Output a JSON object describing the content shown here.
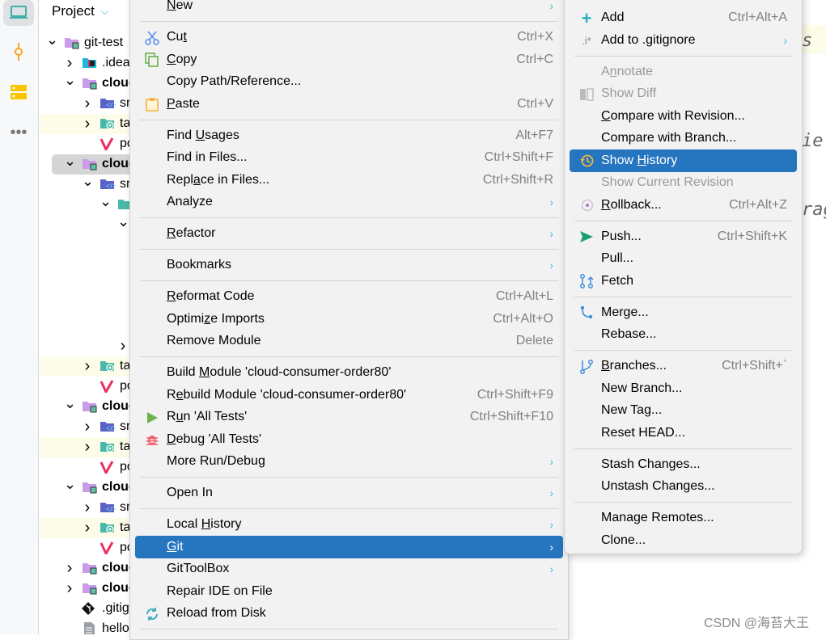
{
  "project": {
    "title": "Project",
    "rows": [
      {
        "lvl": 0,
        "ch": "v",
        "ic": "module",
        "t": "git-test"
      },
      {
        "lvl": 1,
        "ch": ">",
        "ic": "idea",
        "t": ".idea"
      },
      {
        "lvl": 1,
        "ch": "v",
        "ic": "module",
        "t": "cloud",
        "b": true
      },
      {
        "lvl": 2,
        "ch": ">",
        "ic": "src",
        "t": "src"
      },
      {
        "lvl": 2,
        "ch": ">",
        "ic": "target",
        "t": "target",
        "hl": true
      },
      {
        "lvl": 2,
        "ch": "",
        "ic": "maven",
        "t": "pom.xml"
      },
      {
        "lvl": 1,
        "ch": "v",
        "ic": "module",
        "t": "cloud",
        "b": true,
        "sel": true
      },
      {
        "lvl": 2,
        "ch": "v",
        "ic": "src",
        "t": "src"
      },
      {
        "lvl": 3,
        "ch": "v",
        "ic": "folder",
        "t": ""
      },
      {
        "lvl": 4,
        "ch": "v",
        "ic": "",
        "t": ""
      },
      {
        "lvl": 4,
        "ch": "",
        "ic": "",
        "t": ""
      },
      {
        "lvl": 4,
        "ch": "",
        "ic": "",
        "t": ""
      },
      {
        "lvl": 4,
        "ch": "",
        "ic": "",
        "t": ""
      },
      {
        "lvl": 4,
        "ch": "",
        "ic": "",
        "t": ""
      },
      {
        "lvl": 4,
        "ch": "",
        "ic": "",
        "t": ""
      },
      {
        "lvl": 4,
        "ch": ">",
        "ic": "",
        "t": ""
      },
      {
        "lvl": 2,
        "ch": ">",
        "ic": "target",
        "t": "target",
        "hl": true
      },
      {
        "lvl": 2,
        "ch": "",
        "ic": "maven",
        "t": "pom.xml"
      },
      {
        "lvl": 1,
        "ch": "v",
        "ic": "module",
        "t": "cloud",
        "b": true
      },
      {
        "lvl": 2,
        "ch": ">",
        "ic": "src",
        "t": "src"
      },
      {
        "lvl": 2,
        "ch": ">",
        "ic": "target",
        "t": "target",
        "hl": true
      },
      {
        "lvl": 2,
        "ch": "",
        "ic": "maven",
        "t": "pom.xml"
      },
      {
        "lvl": 1,
        "ch": "v",
        "ic": "module",
        "t": "cloud",
        "b": true
      },
      {
        "lvl": 2,
        "ch": ">",
        "ic": "src",
        "t": "src"
      },
      {
        "lvl": 2,
        "ch": ">",
        "ic": "target",
        "t": "target",
        "hl": true
      },
      {
        "lvl": 2,
        "ch": "",
        "ic": "maven",
        "t": "pom.xml"
      },
      {
        "lvl": 1,
        "ch": ">",
        "ic": "module",
        "t": "cloud",
        "b": true
      },
      {
        "lvl": 1,
        "ch": ">",
        "ic": "module",
        "t": "cloud",
        "b": true
      },
      {
        "lvl": 1,
        "ch": "",
        "ic": "git",
        "t": ".gitignore"
      },
      {
        "lvl": 1,
        "ch": "",
        "ic": "file",
        "t": "hello"
      }
    ]
  },
  "main_menu": [
    {
      "l": "New",
      "u": 0,
      "arr": true
    },
    {
      "sep": true
    },
    {
      "l": "Cut",
      "u": 2,
      "sc": "Ctrl+X",
      "ic": "cut"
    },
    {
      "l": "Copy",
      "u": 0,
      "sc": "Ctrl+C",
      "ic": "copy"
    },
    {
      "l": "Copy Path/Reference..."
    },
    {
      "l": "Paste",
      "u": 0,
      "sc": "Ctrl+V",
      "ic": "paste"
    },
    {
      "sep": true
    },
    {
      "l": "Find Usages",
      "u": 5,
      "sc": "Alt+F7"
    },
    {
      "l": "Find in Files...",
      "sc": "Ctrl+Shift+F"
    },
    {
      "l": "Replace in Files...",
      "u": 4,
      "sc": "Ctrl+Shift+R"
    },
    {
      "l": "Analyze",
      "arr": true
    },
    {
      "sep": true
    },
    {
      "l": "Refactor",
      "u": 0,
      "arr": true
    },
    {
      "sep": true
    },
    {
      "l": "Bookmarks",
      "arr": true
    },
    {
      "sep": true
    },
    {
      "l": "Reformat Code",
      "u": 0,
      "sc": "Ctrl+Alt+L"
    },
    {
      "l": "Optimize Imports",
      "u": 6,
      "sc": "Ctrl+Alt+O"
    },
    {
      "l": "Remove Module",
      "sc": "Delete"
    },
    {
      "sep": true
    },
    {
      "l": "Build Module 'cloud-consumer-order80'",
      "u": 6
    },
    {
      "l": "Rebuild Module 'cloud-consumer-order80'",
      "u": 1,
      "sc": "Ctrl+Shift+F9"
    },
    {
      "l": "Run 'All Tests'",
      "u": 1,
      "sc": "Ctrl+Shift+F10",
      "ic": "run"
    },
    {
      "l": "Debug 'All Tests'",
      "u": 0,
      "ic": "debug"
    },
    {
      "l": "More Run/Debug",
      "arr": true
    },
    {
      "sep": true
    },
    {
      "l": "Open In",
      "arr": true
    },
    {
      "sep": true
    },
    {
      "l": "Local History",
      "u": 6,
      "arr": true
    },
    {
      "l": "Git",
      "u": 0,
      "arr": true,
      "act": true
    },
    {
      "l": "GitToolBox",
      "arr": true
    },
    {
      "l": "Repair IDE on File"
    },
    {
      "l": "Reload from Disk",
      "ic": "reload"
    },
    {
      "sep": true
    }
  ],
  "git_menu": [
    {
      "l": ""
    },
    {
      "l": "Add",
      "sc": "Ctrl+Alt+A",
      "ic": "add"
    },
    {
      "l": "Add to .gitignore",
      "arr": true,
      "ic": "gitignore"
    },
    {
      "sep": true
    },
    {
      "l": "Annotate",
      "u": 1,
      "dis": true
    },
    {
      "l": "Show Diff",
      "dis": true,
      "ic": "diff"
    },
    {
      "l": "Compare with Revision...",
      "u": 0
    },
    {
      "l": "Compare with Branch..."
    },
    {
      "l": "Show History",
      "u": 5,
      "act": true,
      "ic": "history"
    },
    {
      "l": "Show Current Revision",
      "dis": true
    },
    {
      "l": "Rollback...",
      "u": 0,
      "sc": "Ctrl+Alt+Z",
      "ic": "rollback"
    },
    {
      "sep": true
    },
    {
      "l": "Push...",
      "sc": "Ctrl+Shift+K",
      "ic": "push"
    },
    {
      "l": "Pull..."
    },
    {
      "l": "Fetch",
      "ic": "fetch"
    },
    {
      "sep": true
    },
    {
      "l": "Merge...",
      "ic": "merge"
    },
    {
      "l": "Rebase..."
    },
    {
      "sep": true
    },
    {
      "l": "Branches...",
      "u": 0,
      "sc": "Ctrl+Shift+`",
      "ic": "branch"
    },
    {
      "l": "New Branch..."
    },
    {
      "l": "New Tag..."
    },
    {
      "l": "Reset HEAD..."
    },
    {
      "sep": true
    },
    {
      "l": "Stash Changes..."
    },
    {
      "l": "Unstash Changes..."
    },
    {
      "sep": true
    },
    {
      "l": "Manage Remotes..."
    },
    {
      "l": "Clone..."
    }
  ],
  "editor": {
    "frag1": "s",
    "frag2": "ie",
    "frag3": "rag"
  },
  "watermark": "CSDN @海苔大王",
  "colors": {
    "accent": "#2675bf",
    "menu_bg": "#f2f2f2",
    "highlight_row": "#fcfce8"
  }
}
